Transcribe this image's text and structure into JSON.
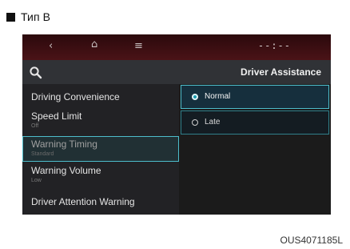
{
  "header": {
    "text": "Тип B"
  },
  "figure_code": "OUS4071185L",
  "status_bar": {
    "back_glyph": "‹",
    "home_glyph": "⌂",
    "menu_glyph": "≡",
    "clock": "--:--"
  },
  "left_menu": {
    "items": [
      {
        "label": "Driving Convenience",
        "sub": ""
      },
      {
        "label": "Speed Limit",
        "sub": "Off"
      },
      {
        "label": "Warning Timing",
        "sub": "Standard"
      },
      {
        "label": "Warning Volume",
        "sub": "Low"
      },
      {
        "label": "Driver Attention Warning",
        "sub": ""
      }
    ]
  },
  "right_panel": {
    "title": "Driver Assistance",
    "options": [
      {
        "label": "Normal",
        "selected": true
      },
      {
        "label": "Late",
        "selected": false
      }
    ]
  },
  "colors": {
    "accent": "#4dbdcb",
    "status_bar": "#3a0f12",
    "screen_bg": "#1d1d1d"
  },
  "icons": {
    "back": "back-arrow-icon",
    "home": "home-icon",
    "menu": "menu-icon",
    "search": "search-icon"
  }
}
